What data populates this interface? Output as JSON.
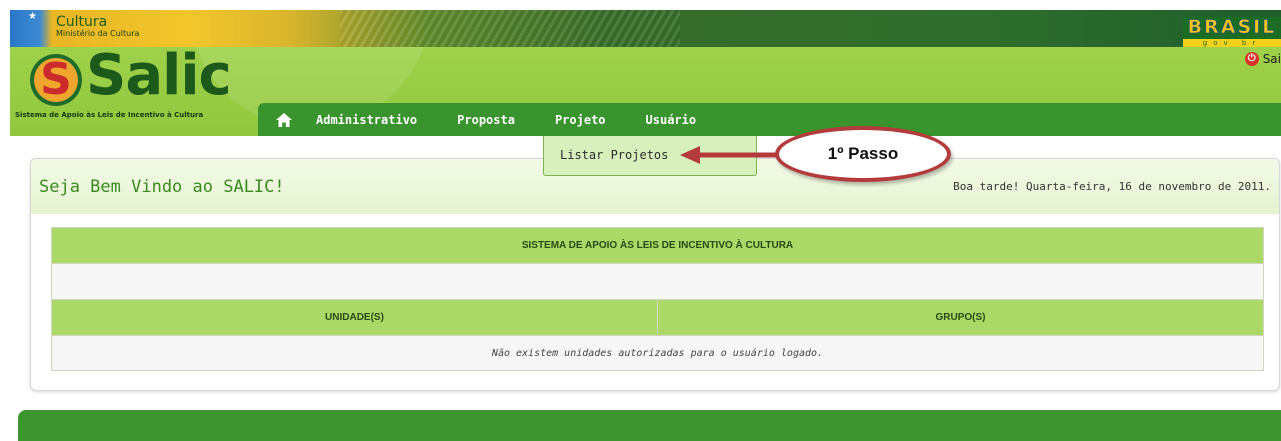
{
  "topbar": {
    "ministry_title": "Cultura",
    "ministry_subtitle": "Ministério da Cultura",
    "country_badge": "BRASIL",
    "country_badge_sub": "gov br"
  },
  "header": {
    "logo_text": "Salic",
    "logo_letter": "S",
    "tagline": "Sistema de Apoio às Leis de Incentivo à Cultura",
    "logout_label": "Sai"
  },
  "nav": {
    "items": [
      {
        "label": "Administrativo"
      },
      {
        "label": "Proposta"
      },
      {
        "label": "Projeto"
      },
      {
        "label": "Usuário"
      }
    ]
  },
  "submenu": {
    "items": [
      {
        "label": "Listar Projetos"
      }
    ]
  },
  "annotation": {
    "label": "1º Passo",
    "color": "#b33b3b"
  },
  "main": {
    "welcome_title": "Seja Bem Vindo ao SALIC!",
    "greeting": "Boa tarde! Quarta-feira, 16 de novembro de 2011.",
    "table": {
      "title": "SISTEMA DE APOIO ÀS LEIS DE INCENTIVO À CULTURA",
      "columns": [
        "UNIDADE(S)",
        "GRUPO(S)"
      ],
      "empty_message": "Não existem unidades autorizadas para o usuário logado."
    }
  },
  "colors": {
    "header_green": "#9acd44",
    "nav_green": "#3a942e",
    "table_header": "#abd866",
    "title_green": "#3a8a20"
  },
  "icons": [
    "home-icon",
    "power-icon"
  ]
}
